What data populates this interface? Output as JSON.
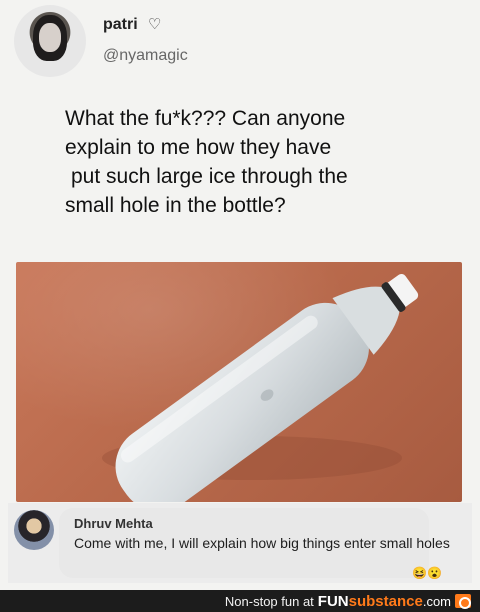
{
  "tweet": {
    "display_name": "patri",
    "name_badge": "♡",
    "handle": "@nyamagic",
    "text_lines": [
      "What the fu*k???  Can anyone",
      "explain to me how they have",
      "put such large ice through the",
      "small hole in the bottle?"
    ]
  },
  "photo": {
    "subject": "frozen plastic bottle on a terracotta surface",
    "colors": {
      "background": "#b96a4c",
      "ice": "#dce1e3",
      "cap": "#f4f4f4"
    }
  },
  "comment": {
    "author": "Dhruv Mehta",
    "text": "Come with me, I will explain how big things enter small holes",
    "reactions": "😆😮"
  },
  "watermark": {
    "text": "Non-stop fun at",
    "brand_part1": "FUN",
    "brand_part2": "substance",
    "brand_part3": ".com",
    "icon": "funsubstance-logo-icon"
  },
  "colors": {
    "page_background": "#f3f3f1",
    "comment_bubble": "#e8e8e8",
    "watermark_bar": "#1c1c1c",
    "brand_accent": "#ff7a1a"
  }
}
